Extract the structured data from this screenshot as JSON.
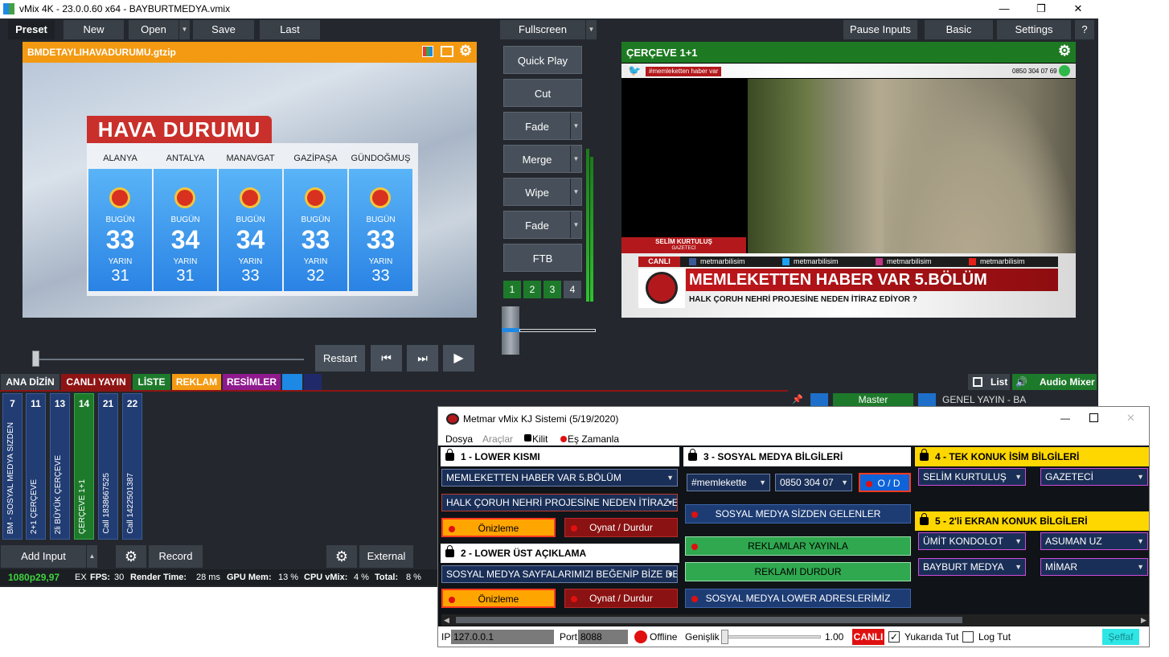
{
  "vmix": {
    "title": "vMix 4K - 23.0.0.60 x64 - BAYBURTMEDYA.vmix",
    "win_min": "—",
    "win_max": "❐",
    "win_close": "✕",
    "toolbar": {
      "preset": "Preset",
      "new": "New",
      "open": "Open",
      "save": "Save",
      "last": "Last",
      "fullscreen": "Fullscreen",
      "pause_inputs": "Pause Inputs",
      "basic": "Basic",
      "settings": "Settings",
      "help": "?"
    },
    "preview": {
      "title": "BMDETAYLIHAVADURUMU.gtzip",
      "weather_title": "HAVA DURUMU",
      "today_label": "BUGÜN",
      "tomorrow_label": "YARIN",
      "cities": [
        {
          "name": "ALANYA",
          "today": "33",
          "tomorrow": "31"
        },
        {
          "name": "ANTALYA",
          "today": "34",
          "tomorrow": "31"
        },
        {
          "name": "MANAVGAT",
          "today": "34",
          "tomorrow": "33"
        },
        {
          "name": "GAZİPAŞA",
          "today": "33",
          "tomorrow": "32"
        },
        {
          "name": "GÜNDOĞMUŞ",
          "today": "33",
          "tomorrow": "33"
        }
      ]
    },
    "transitions": {
      "quick_play": "Quick Play",
      "cut": "Cut",
      "fade": "Fade",
      "merge": "Merge",
      "wipe": "Wipe",
      "fade2": "Fade",
      "ftb": "FTB",
      "numbers": [
        "1",
        "2",
        "3",
        "4"
      ]
    },
    "program": {
      "title": "ÇERÇEVE 1+1",
      "hashtag": "#memleketten haber var",
      "phone": "0850 304 07 69",
      "guest_name": "SELİM KURTULUŞ",
      "guest_title": "GAZETECİ",
      "live_label": "CANLI",
      "social": [
        "metmarbilisim",
        "metmarbilisim",
        "metmarbilisim",
        "metmarbilisim"
      ],
      "headline": "MEMLEKETTEN HABER VAR 5.BÖLÜM",
      "subline": "HALK ÇORUH NEHRİ PROJESİNE NEDEN İTİRAZ EDİYOR ?"
    },
    "playback": {
      "restart": "Restart"
    },
    "categories": [
      "ANA DİZİN",
      "CANLI YAYIN",
      "LİSTE",
      "REKLAM",
      "RESİMLER"
    ],
    "list_label": "List",
    "audio_mixer_label": "Audio Mixer",
    "master_label": "Master",
    "bus_label": "GENEL YAYIN - BA",
    "inputs": [
      {
        "num": "7",
        "label": "BM - SOSYAL MEDYA SIZDEN"
      },
      {
        "num": "11",
        "label": "2+1 ÇERÇEVE"
      },
      {
        "num": "13",
        "label": "2li BÜYÜK ÇERÇEVE"
      },
      {
        "num": "14",
        "label": "ÇERÇEVE 1+1"
      },
      {
        "num": "21",
        "label": "Call 1838667525"
      },
      {
        "num": "22",
        "label": "Call 1422501387"
      }
    ],
    "bottom": {
      "add_input": "Add Input",
      "record": "Record",
      "external": "External"
    },
    "status": {
      "format": "1080p29,97",
      "ex": "EX",
      "fps_label": "FPS:",
      "fps": "30",
      "render_label": "Render Time:",
      "render": "28 ms",
      "gpu_label": "GPU Mem:",
      "gpu": "13 %",
      "cpu_label": "CPU vMix:",
      "cpu": "4 %",
      "total_label": "Total:",
      "total": "8 %"
    }
  },
  "kj": {
    "title": "Metmar vMix KJ Sistemi (5/19/2020)",
    "menu": {
      "dosya": "Dosya",
      "araclar": "Araçlar",
      "kilit": "Kilit",
      "es_zamanla": "Eş Zamanla"
    },
    "sec1": {
      "title": "1 - LOWER KISMI",
      "line1": "MEMLEKETTEN HABER VAR 5.BÖLÜM",
      "line2": "HALK ÇORUH NEHRİ PROJESİNE NEDEN İTİRAZ ED",
      "preview": "Önizleme",
      "play": "Oynat / Durdur"
    },
    "sec2": {
      "title": "2 - LOWER ÜST AÇIKLAMA",
      "line1": "SOSYAL MEDYA SAYFALARIMIZI BEĞENİP BİZE DES",
      "preview": "Önizleme",
      "play": "Oynat / Durdur"
    },
    "sec3": {
      "title": "3 - SOSYAL MEDYA BİLGİLERİ",
      "hashtag": "#memlekette",
      "phone": "0850 304 07",
      "od": "O / D",
      "b1": "SOSYAL MEDYA SİZDEN GELENLER",
      "b2": "REKLAMLAR YAYINLA",
      "b3": "REKLAMI DURDUR",
      "b4": "SOSYAL MEDYA LOWER ADRESLERİMİZ"
    },
    "sec4": {
      "title": "4 - TEK KONUK İSİM BİLGİLERİ",
      "name": "SELİM KURTULUŞ",
      "job": "GAZETECİ"
    },
    "sec5": {
      "title": "5 - 2'li EKRAN KONUK BİLGİLERİ",
      "name1": "ÜMİT KONDOLOT",
      "job1": "ASUMAN UZ",
      "name2": "BAYBURT MEDYA",
      "job2": "MİMAR"
    },
    "footer": {
      "ip_label": "IP",
      "ip": "127.0.0.1",
      "port_label": "Port",
      "port": "8088",
      "offline": "Offline",
      "width_label": "Genişlik",
      "width_value": "1.00",
      "live": "CANLI",
      "on_top": "Yukarıda Tut",
      "log": "Log Tut",
      "transparent": "Şeffaf"
    }
  }
}
